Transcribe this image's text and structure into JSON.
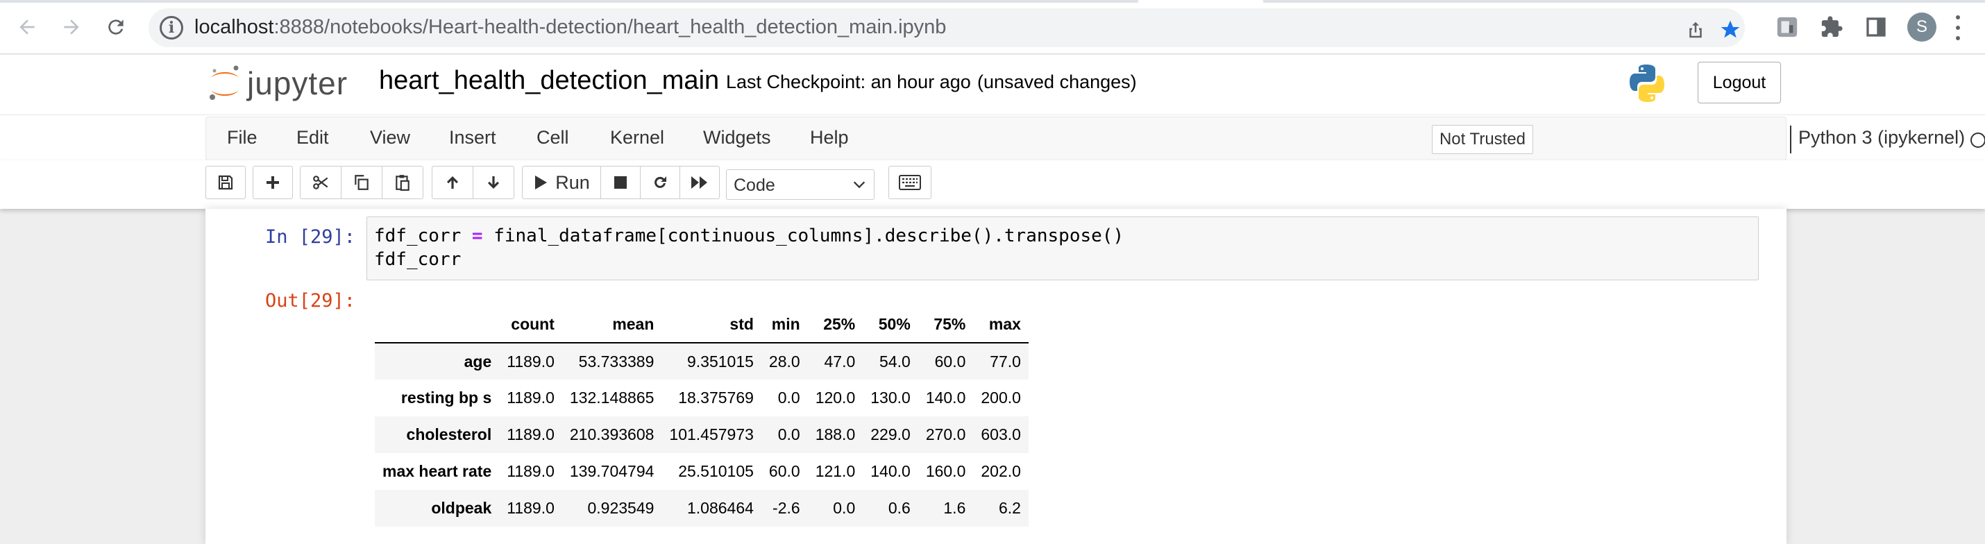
{
  "browser": {
    "url_host": "localhost",
    "url_path": ":8888/notebooks/Heart-health-detection/heart_health_detection_main.ipynb",
    "profile_initial": "S"
  },
  "header": {
    "logo_text": "jupyter",
    "notebook_title": "heart_health_detection_main",
    "checkpoint": "Last Checkpoint: an hour ago",
    "unsaved": "(unsaved changes)",
    "logout_label": "Logout"
  },
  "menubar": {
    "items": [
      "File",
      "Edit",
      "View",
      "Insert",
      "Cell",
      "Kernel",
      "Widgets",
      "Help"
    ],
    "trust_label": "Not Trusted",
    "kernel_name": "Python 3 (ipykernel)"
  },
  "toolbar": {
    "run_label": "Run",
    "cell_type": "Code"
  },
  "cell": {
    "in_prompt": "In [29]:",
    "code_line1_lhs": "fdf_corr ",
    "code_line1_op": "=",
    "code_line1_rhs": " final_dataframe[continuous_columns].describe().transpose()",
    "code_line2": "fdf_corr",
    "out_prompt": "Out[29]:"
  },
  "dataframe": {
    "columns": [
      "count",
      "mean",
      "std",
      "min",
      "25%",
      "50%",
      "75%",
      "max"
    ],
    "rows": [
      {
        "index": "age",
        "values": [
          "1189.0",
          "53.733389",
          "9.351015",
          "28.0",
          "47.0",
          "54.0",
          "60.0",
          "77.0"
        ]
      },
      {
        "index": "resting bp s",
        "values": [
          "1189.0",
          "132.148865",
          "18.375769",
          "0.0",
          "120.0",
          "130.0",
          "140.0",
          "200.0"
        ]
      },
      {
        "index": "cholesterol",
        "values": [
          "1189.0",
          "210.393608",
          "101.457973",
          "0.0",
          "188.0",
          "229.0",
          "270.0",
          "603.0"
        ]
      },
      {
        "index": "max heart rate",
        "values": [
          "1189.0",
          "139.704794",
          "25.510105",
          "60.0",
          "121.0",
          "140.0",
          "160.0",
          "202.0"
        ]
      },
      {
        "index": "oldpeak",
        "values": [
          "1189.0",
          "0.923549",
          "1.086464",
          "-2.6",
          "0.0",
          "0.6",
          "1.6",
          "6.2"
        ]
      }
    ]
  }
}
